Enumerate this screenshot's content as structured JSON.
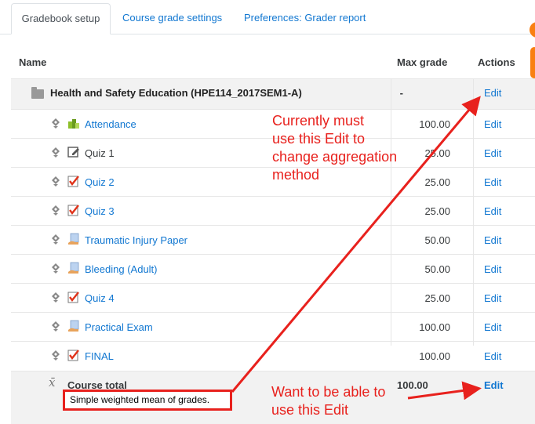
{
  "tabs": [
    {
      "label": "Gradebook setup",
      "active": true
    },
    {
      "label": "Course grade settings",
      "active": false
    },
    {
      "label": "Preferences: Grader report",
      "active": false
    }
  ],
  "table": {
    "headers": {
      "name": "Name",
      "max": "Max grade",
      "actions": "Actions"
    },
    "category": {
      "title": "Health and Safety Education (HPE114_2017SEM1-A)",
      "max": "-",
      "action": "Edit"
    },
    "rows": [
      {
        "name": "Attendance",
        "icon": "attendance-icon",
        "link": true,
        "max": "100.00",
        "action": "Edit"
      },
      {
        "name": "Quiz 1",
        "icon": "edit-pencil-icon",
        "link": false,
        "max": "25.00",
        "action": "Edit"
      },
      {
        "name": "Quiz 2",
        "icon": "quiz-checkmark-icon",
        "link": true,
        "max": "25.00",
        "action": "Edit"
      },
      {
        "name": "Quiz 3",
        "icon": "quiz-checkmark-icon",
        "link": true,
        "max": "25.00",
        "action": "Edit"
      },
      {
        "name": "Traumatic Injury Paper",
        "icon": "assignment-hand-icon",
        "link": true,
        "max": "50.00",
        "action": "Edit"
      },
      {
        "name": "Bleeding (Adult)",
        "icon": "assignment-hand-icon",
        "link": true,
        "max": "50.00",
        "action": "Edit"
      },
      {
        "name": "Quiz 4",
        "icon": "quiz-checkmark-icon",
        "link": true,
        "max": "25.00",
        "action": "Edit"
      },
      {
        "name": "Practical Exam",
        "icon": "assignment-hand-icon",
        "link": true,
        "max": "100.00",
        "action": "Edit"
      },
      {
        "name": "FINAL",
        "icon": "quiz-checkmark-icon",
        "link": true,
        "max": "100.00",
        "action": "Edit"
      }
    ],
    "total": {
      "label": "Course total",
      "max": "100.00",
      "action": "Edit",
      "aggregation": "Simple weighted mean of grades.",
      "symbol": "x̄"
    }
  },
  "annotations": {
    "top": [
      "Currently must",
      "use this Edit to",
      "change aggregation",
      "method"
    ],
    "bottom": [
      "Want to be able to",
      "use this Edit"
    ],
    "color": "#e8211d"
  },
  "colors": {
    "link": "#1177d1",
    "category_bg": "#f2f2f2",
    "brand_orange": "#f98012"
  }
}
